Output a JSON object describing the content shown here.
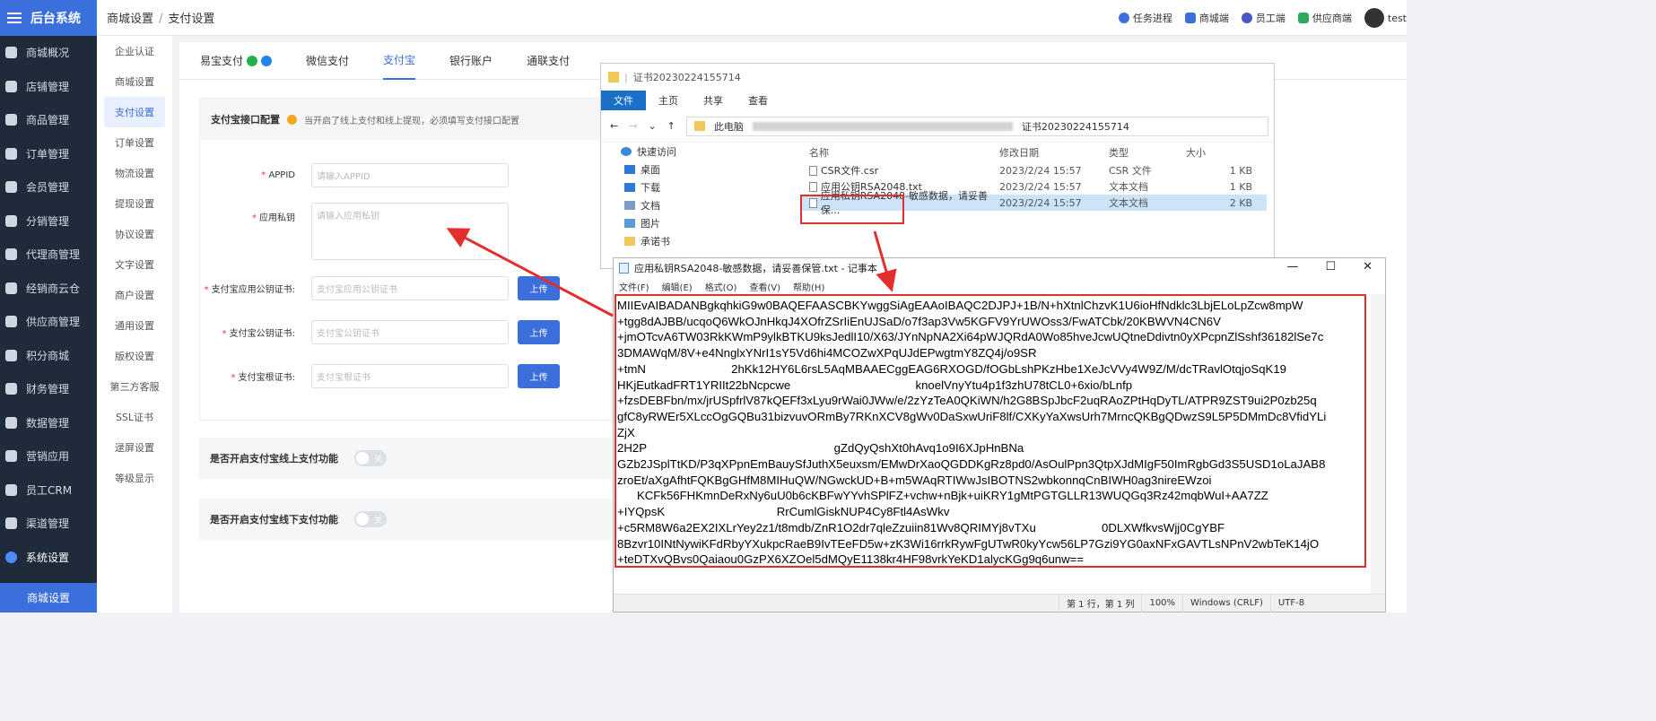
{
  "app": {
    "title": "后台系统"
  },
  "sidebar": {
    "items": [
      {
        "label": "商城概况"
      },
      {
        "label": "店铺管理"
      },
      {
        "label": "商品管理"
      },
      {
        "label": "订单管理"
      },
      {
        "label": "会员管理"
      },
      {
        "label": "分销管理"
      },
      {
        "label": "代理商管理"
      },
      {
        "label": "经销商云仓"
      },
      {
        "label": "供应商管理"
      },
      {
        "label": "积分商城"
      },
      {
        "label": "财务管理"
      },
      {
        "label": "数据管理"
      },
      {
        "label": "营销应用"
      },
      {
        "label": "员工CRM"
      },
      {
        "label": "渠道管理"
      },
      {
        "label": "系统设置"
      }
    ],
    "active_sub": "商城设置"
  },
  "breadcrumb": {
    "parent": "商城设置",
    "sep": "/",
    "current": "支付设置"
  },
  "top_links": [
    {
      "label": "任务进程",
      "color": "#3a6fdc"
    },
    {
      "label": "商城端",
      "color": "#3a6fdc"
    },
    {
      "label": "员工端",
      "color": "#4a55c8"
    },
    {
      "label": "供应商端",
      "color": "#2eaa5c"
    }
  ],
  "user": {
    "name": "test"
  },
  "subnav": {
    "items": [
      "企业认证",
      "商城设置",
      "支付设置",
      "订单设置",
      "物流设置",
      "提现设置",
      "协议设置",
      "文字设置",
      "商户设置",
      "通用设置",
      "版权设置",
      "第三方客服",
      "SSL证书",
      "逯屏设置",
      "等级显示"
    ]
  },
  "tabs": [
    {
      "label": "易宝支付"
    },
    {
      "label": "微信支付"
    },
    {
      "label": "支付宝"
    },
    {
      "label": "银行账户"
    },
    {
      "label": "通联支付"
    }
  ],
  "config": {
    "title": "支付宝接口配置",
    "note": "当开启了线上支付和线上提现，必须填写支付接口配置",
    "fields": [
      {
        "label": "APPID",
        "placeholder": "请输入APPID"
      },
      {
        "label": "应用私钥",
        "placeholder": "请输入应用私钥"
      },
      {
        "label": "支付宝应用公钥证书:",
        "placeholder": "支付宝应用公钥证书",
        "button": "上传"
      },
      {
        "label": "支付宝公钥证书:",
        "placeholder": "支付宝公钥证书",
        "button": "上传"
      },
      {
        "label": "支付宝根证书:",
        "placeholder": "支付宝根证书",
        "button": "上传"
      }
    ]
  },
  "toggles": [
    {
      "label": "是否开启支付宝线上支付功能",
      "state": "关"
    },
    {
      "label": "是否开启支付宝线下支付功能",
      "state": "关"
    }
  ],
  "explorer": {
    "title": "证书20230224155714",
    "ribbon": [
      "文件",
      "主页",
      "共享",
      "查看"
    ],
    "address": {
      "root": "此电脑",
      "folder": "证书20230224155714"
    },
    "quick": [
      {
        "label": "快速访问"
      },
      {
        "label": "桌面"
      },
      {
        "label": "下载"
      },
      {
        "label": "文档"
      },
      {
        "label": "图片"
      },
      {
        "label": "承诺书"
      }
    ],
    "columns": [
      "名称",
      "修改日期",
      "类型",
      "大小"
    ],
    "files": [
      {
        "name": "CSR文件.csr",
        "date": "2023/2/24 15:57",
        "type": "CSR 文件",
        "size": "1 KB"
      },
      {
        "name": "应用公钥RSA2048.txt",
        "date": "2023/2/24 15:57",
        "type": "文本文档",
        "size": "1 KB"
      },
      {
        "name": "应用私钥RSA2048-敏感数据，请妥善保...",
        "date": "2023/2/24 15:57",
        "type": "文本文档",
        "size": "2 KB"
      }
    ]
  },
  "notepad": {
    "title": "应用私钥RSA2048-敏感数据，请妥善保管.txt - 记事本",
    "menu": [
      "文件(F)",
      "编辑(E)",
      "格式(O)",
      "查看(V)",
      "帮助(H)"
    ],
    "content": "MIIEvAIBADANBgkqhkiG9w0BAQEFAASCBKYwggSiAgEAAoIBAQC2DJPJ+1B/N+hXtnlChzvK1U6ioHfNdklc3LbjELoLpZcw8mpW\n+tgg8dAJBB/ucqoQ6WkOJnHkqJ4XOfrZSrIiEnUJSaD/o7f3ap3Vw5KGFV9YrUWOss3/FwATCbk/20KBWVN4CN6V\n+jmOTcvA6TW03RkKWmP9ylkBTKU9ksJedlI10/X63/JYnNpNA2Xi64pWJQRdA0Wo85hveJcwUQtneDdivtn0yXPcpnZlSshf36182lSe7c\n3DMAWqM/8V+e4NnglxYNrI1sY5Vd6hi4MCOZwXPqUJdEPwgtmY8ZQ4j/o9SR\n+tmN                          2hKk12HY6L6rsL5AqMBAAECggEAG6RXOGD/fOGbLshPKzHbe1XeJcVVy4W9Z/M/dcTRavlOtqjoSqK19\nHKjEutkadFRT1YRIIt22bNcpcwe                                      knoelVnyYtu4p1f3zhU78tCL0+6xio/bLnfp\n+fzsDEBFbn/mx/jrUSpfrlV87kQEFf3xLyu9rWai0JWw/e/2zYzTeA0QKiWN/h2G8BSpJbcF2uqRAoZPtHqDyTL/ATPR9ZST9ui2P0zb25q\ngfC8yRWEr5XLccOgGQBu31bizvuvORmBy7RKnXCV8gWv0DaSxwUriF8lf/CXKyYaXwsUrh7MrncQKBgQDwzS9L5P5DMmDc8VfidYLi\nZjX                                                                                                 \n2H2P                                                         gZdQyQshXt0hAvq1o9I6XJpHnBNa\nGZb2JSplTtKD/P3qXPpnEmBauySfJuthX5euxsm/EMwDrXaoQGDDKgRz8pd0/AsOulPpn3QtpXJdMIgF50ImRgbGd3S5USD1oLaJAB8\nzroEt/aXgAfhtFQKBgGHfM8MIHuQW/NGwckUD+B+m5WAqRTIWwJsIBOTNS2wbkonnqCnBIWH0ag3nireEWzoi\n      KCFk56FHKmnDeRxNy6uU0b6cKBFwYYvhSPlFZ+vchw+nBjk+uiKRY1gMtPGTGLLR13WUQGq3Rz42mqbWuI+AA7ZZ\n+IYQpsK                                  RrCumlGiskNUP4Cy8Ftl4AsWkv\n+c5RM8W6a2EX2IXLrYey2z1/t8mdb/ZnR1O2dr7qleZzuiin81Wv8QRIMYj8vTXu                    0DLXWfkvsWjj0CgYBF\n8Bzvr10INtNywiKFdRbyYXukpcRaeB9IvTEeFD5w+zK3Wi16rrkRywFgUTwR0kyYcw56LP7Gzi9YG0axNFxGAVTLsNPnV2wbTeK14jO\n+teDTXvQBvs0Qaiaou0GzPX6XZOel5dMQyE1138kr4HF98vrkYeKD1alycKGg9q6unw==",
    "status": {
      "pos": "第 1 行，第 1 列",
      "zoom": "100%",
      "eol": "Windows (CRLF)",
      "enc": "UTF-8"
    }
  }
}
